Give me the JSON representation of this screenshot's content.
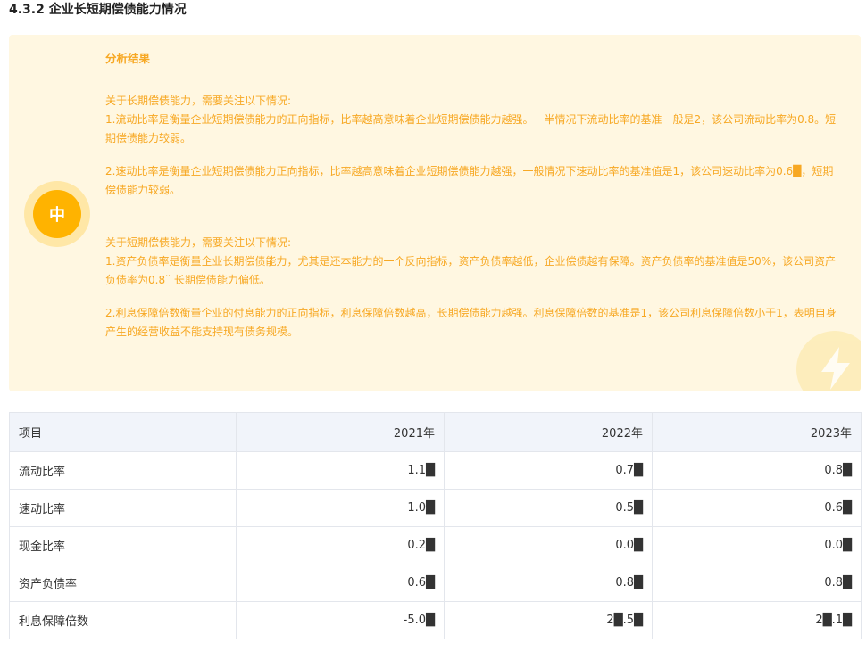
{
  "section": {
    "title": "4.3.2 企业长短期偿债能力情况"
  },
  "analysis": {
    "heading": "分析结果",
    "level_label": "中",
    "icons": {
      "badge": "level-badge",
      "decoration": "lightning-bolt-icon"
    },
    "paragraphs": [
      "关于长期偿债能力，需要关注以下情况:",
      "1.流动比率是衡量企业短期偿债能力的正向指标，比率越高意味着企业短期偿债能力越强。一半情况下流动比率的基准一般是2，该公司流动比率为0.8。短期偿债能力较弱。",
      "2.速动比率是衡量企业短期偿债能力正向指标，比率越高意味着企业短期偿债能力越强，一般情况下速动比率的基准值是1，该公司速动比率为0.6█，短期偿债能力较弱。",
      "关于短期偿债能力，需要关注以下情况:",
      "1.资产负债率是衡量企业长期偿债能力，尤其是还本能力的一个反向指标，资产负债率越低，企业偿债越有保障。资产负债率的基准值是50%，该公司资产负债率为0.8˘ 长期偿债能力偏低。",
      "2.利息保障倍数衡量企业的付息能力的正向指标，利息保障倍数越高，长期偿债能力越强。利息保障倍数的基准是1，该公司利息保障倍数小于1，表明自身产生的经营收益不能支持现有债务规模。"
    ]
  },
  "table": {
    "headers": [
      "项目",
      "2021年",
      "2022年",
      "2023年"
    ],
    "rows": [
      [
        "流动比率",
        "1.1█",
        "0.7█",
        "0.8█"
      ],
      [
        "速动比率",
        "1.0█",
        "0.5█",
        "0.6█"
      ],
      [
        "现金比率",
        "0.2█",
        "0.0█",
        "0.0█"
      ],
      [
        "资产负债率",
        "0.6█",
        "0.8█",
        "0.8█"
      ],
      [
        "利息保障倍数",
        "-5.0█",
        "2█.5█",
        "2█.1█"
      ]
    ]
  },
  "colors": {
    "accent": "#f7a823",
    "badge": "#ffb300",
    "card_bg": "#fff7e1",
    "table_header_bg": "#f1f4fa",
    "border": "#e3e6ec"
  }
}
